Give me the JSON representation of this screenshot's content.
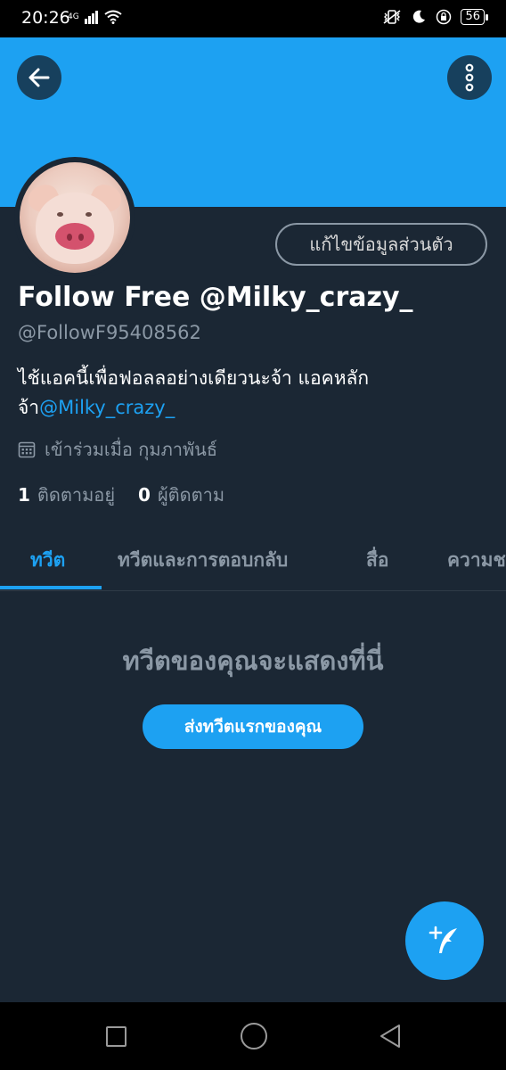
{
  "status_bar": {
    "time": "20:26",
    "network": "4G",
    "battery": "56"
  },
  "profile": {
    "edit_label": "แก้ไขข้อมูลส่วนตัว",
    "display_name": "Follow Free @Milky_crazy_",
    "handle": "@FollowF95408562",
    "bio_text": "ไช้แอคนี้เพื่อฟอลลอย่างเดียวนะจ้า แอคหลัก จ้า",
    "bio_mention": "@Milky_crazy_",
    "joined": "เข้าร่วมเมื่อ กุมภาพันธ์",
    "following_count": "1",
    "following_label": "ติดตามอยู่",
    "followers_count": "0",
    "followers_label": "ผู้ติดตาม"
  },
  "tabs": [
    {
      "label": "ทวีต",
      "active": true
    },
    {
      "label": "ทวีตและการตอบกลับ",
      "active": false
    },
    {
      "label": "สื่อ",
      "active": false
    },
    {
      "label": "ความช",
      "active": false
    }
  ],
  "empty_state": {
    "title": "ทวีตของคุณจะแสดงที่นี่",
    "button_label": "ส่งทวีตแรกของคุณ"
  },
  "colors": {
    "accent": "#1da1f2",
    "background": "#15202b",
    "secondary_text": "#8b98a5"
  },
  "icons": {
    "back": "arrow-left-icon",
    "more": "more-vertical-icon",
    "calendar": "calendar-icon",
    "compose": "feather-plus-icon"
  }
}
